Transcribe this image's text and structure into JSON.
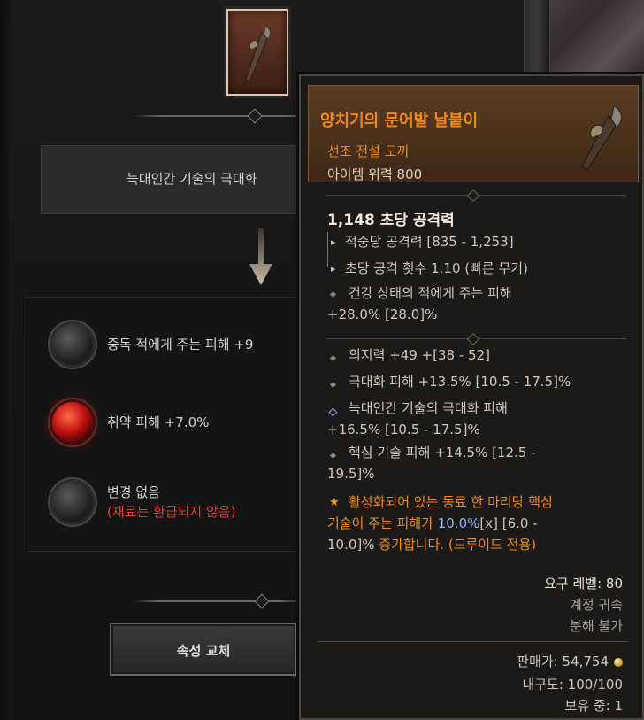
{
  "left_panel": {
    "skill_label": "늑대인간 기술의 극대화",
    "options": [
      {
        "text": "중독 적에게 주는 피해 +9",
        "orb": "gray-orb-icon"
      },
      {
        "text": "취약 피해 +7.0%",
        "orb": "red-orb-icon"
      },
      {
        "text": "변경 없음",
        "note": "(재료는 환급되지 않음)",
        "orb": "gray-orb-icon"
      }
    ],
    "replace_button": "속성 교체"
  },
  "tooltip": {
    "name": "양치기의 문어발 날붙이",
    "type": "선조 전설 도끼",
    "power": "아이템 위력 800",
    "dps": "1,148 초당 공격력",
    "damage_per_hit": "적중당 공격력 [835 - 1,253]",
    "attacks_per_second": "초당 공격 횟수 1.10 (빠른 무기)",
    "implicit_1": "건강 상태의 적에게 주는 피해",
    "implicit_2": "+28.0% [28.0]%",
    "affixes": [
      "의지력 +49 +[38 - 52]",
      "극대화 피해 +13.5% [10.5 - 17.5]%",
      "늑대인간 기술의 극대화 피해",
      "+16.5% [10.5 - 17.5]%",
      "핵심 기술 피해 +14.5% [12.5 -",
      "19.5]%"
    ],
    "legendary": {
      "line1_a": "활성화되어 있는 동료 한 마리당 핵심",
      "line2_a": "기술이 주는 피해가 ",
      "line2_val": "10.0%",
      "line2_b": "[x] [6.0 -",
      "line3_a": "10.0]% ",
      "line3_b": "증가합니다. (드루이드 전용)"
    },
    "required_level": "요구 레벨: 80",
    "account_bound": "계정 귀속",
    "salvage": "분해 불가",
    "sell_value": "판매가: 54,754",
    "durability": "내구도: 100/100",
    "owned": "보유 중: 1"
  },
  "colors": {
    "legendary_orange": "#f08a1e",
    "affix_blue": "#8ab4ff",
    "warning_red": "#e8392c"
  }
}
